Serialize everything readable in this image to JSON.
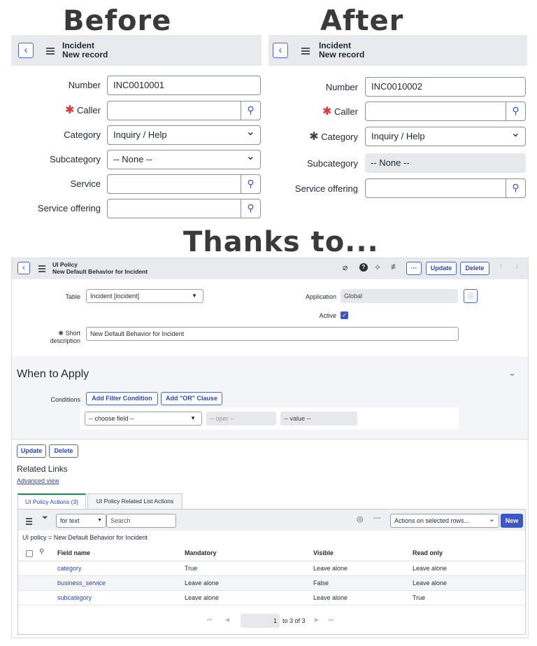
{
  "captions": {
    "before": "Before",
    "after": "After",
    "thanks": "Thanks to..."
  },
  "form_header": {
    "title": "Incident",
    "subtitle": "New record"
  },
  "before_form": {
    "number_label": "Number",
    "number_value": "INC0010001",
    "caller_label": "Caller",
    "category_label": "Category",
    "category_value": "Inquiry / Help",
    "subcategory_label": "Subcategory",
    "subcategory_value": "-- None --",
    "service_label": "Service",
    "service_offering_label": "Service offering"
  },
  "after_form": {
    "number_label": "Number",
    "number_value": "INC0010002",
    "caller_label": "Caller",
    "category_label": "Category",
    "category_value": "Inquiry / Help",
    "subcategory_label": "Subcategory",
    "subcategory_value": "-- None --",
    "service_offering_label": "Service offering"
  },
  "policy": {
    "header_title": "UI Policy",
    "header_subtitle": "New Default Behavior for Incident",
    "more_label": "···",
    "update_label": "Update",
    "delete_label": "Delete",
    "table_label": "Table",
    "table_value": "Incident [incident]",
    "application_label": "Application",
    "application_value": "Global",
    "active_label": "Active",
    "short_desc_label1": "Short",
    "short_desc_label2": "description",
    "short_desc_value": "New Default Behavior for Incident",
    "when_to_apply": "When to Apply",
    "conditions_label": "Conditions",
    "add_filter_label": "Add Filter Condition",
    "add_or_label": "Add \"OR\" Clause",
    "choose_field": "-- choose field --",
    "oper": "-- oper --",
    "value": "-- value --",
    "related_links": "Related Links",
    "advanced_view": "Advanced view"
  },
  "related": {
    "tabs": [
      "UI Policy Actions (3)",
      "UI Policy Related List Actions"
    ],
    "search_field_select": "for text",
    "search_placeholder": "Search",
    "actions_select": "Actions on selected rows...",
    "new_label": "New",
    "breadcrumb": "UI policy = New Default Behavior for Incident",
    "columns": [
      "Field name",
      "Mandatory",
      "Visible",
      "Read only"
    ],
    "rows": [
      [
        "category",
        "True",
        "Leave alone",
        "Leave alone"
      ],
      [
        "business_service",
        "Leave alone",
        "False",
        "Leave alone"
      ],
      [
        "subcategory",
        "Leave alone",
        "Leave alone",
        "True"
      ]
    ],
    "pagination_current": "1",
    "pagination_text": "to 3 of 3"
  },
  "icons": {
    "back": "chevron-left-icon",
    "menu": "hamburger-icon",
    "search": "search-icon",
    "attachment": "paperclip-icon",
    "help": "help-icon",
    "activity": "activity-icon",
    "settings": "sliders-icon",
    "collapse": "chevron-down-icon",
    "filter": "funnel-icon"
  },
  "colors": {
    "accent": "#2c47b3",
    "required": "#e0343a",
    "header_bg": "#e8eaee",
    "readonly_bg": "#e6e8ec"
  }
}
